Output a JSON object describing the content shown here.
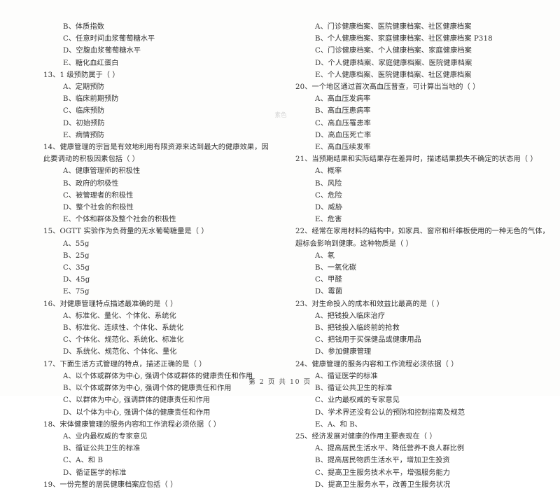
{
  "document": {
    "page_footer": "第 2 页 共 10 页",
    "artifact_text": "素色"
  },
  "left_column": {
    "leading_options": [
      "B、体质指数",
      "C、任意时间血浆葡萄糖水平",
      "D、空腹血浆葡萄糖水平",
      "E、糖化血红蛋白"
    ],
    "questions": [
      {
        "stem": "13、1 级预防属于（    ）",
        "options": [
          "A、定期预防",
          "B、临床前期预防",
          "C、临床预防",
          "D、初始预防",
          "E、病情预防"
        ]
      },
      {
        "stem": "14、健康管理的宗旨是有效地利用有限资源来达到最大的健康效果，因此要调动的积极因素包括（    ）",
        "options": [
          "A、健康管理师的积极性",
          "B、政府的积极性",
          "C、被管理者的积极性",
          "D、整个社会的积极性",
          "E、个体和群体及整个社会的积极性"
        ]
      },
      {
        "stem": "15、OGTT 实验作为负荷量的无水葡萄糖量是（    ）",
        "options": [
          "A、55g",
          "B、25g",
          "C、35g",
          "D、45g",
          "E、75g"
        ]
      },
      {
        "stem": "16、对健康管理特点描述最准确的是（    ）",
        "options": [
          "A、标准化、量化、个体化、系统化",
          "B、标准化、连续性、个体化、系统化",
          "C、个体化、规范化、系统化、标准化",
          "D、系统化、规范化、个体化、量化"
        ]
      },
      {
        "stem": "17、下面生活方式管理的特点，描述正确的是（    ）",
        "options": [
          "A、以个体或群体为中心, 强调个体或群体的健康责任和作用",
          "B、以个体或群体为中心, 强调个体的健康责任和作用",
          "C、以群体为中心, 强调群体的健康责任和作用",
          "D、以个体为中心, 强调个体的健康责任和作用"
        ]
      },
      {
        "stem": "18、宋体健康管理的服务内容和工作流程必须依据（    ）",
        "options": [
          "A、业内最权威的专家意见",
          "B、循证公共卫生的标准",
          "C、A、和 B",
          "D、循证医学的标准"
        ]
      },
      {
        "stem": "19、一份完整的居民健康档案应包括（    ）",
        "options": []
      }
    ]
  },
  "right_column": {
    "leading_options": [
      "A、门诊健康档案、医院健康档案、社区健康档案",
      "B、个人健康档案、家庭健康档案、社区健康档案 P318",
      "C、门诊健康档案、个人健康档案、家庭健康档案",
      "D、个人健康档案、家庭健康档案、医院健康档案",
      "E、个人健康档案、医院健康档案、社区健康档案"
    ],
    "questions": [
      {
        "stem": "20、一个地区通过首次高血压普查，可计算出当地的（    ）",
        "options": [
          "A、高血压发病率",
          "B、高血压患病率",
          "C、高血压罹患率",
          "D、高血压死亡率",
          "E、高血压续发率"
        ]
      },
      {
        "stem": "21、当预期结果和实际结果存在差异时，描述结果损失不确定的状态用（    ）",
        "options": [
          "A、概率",
          "B、风险",
          "C、危险",
          "D、威胁",
          "E、危害"
        ]
      },
      {
        "stem": "22、经常在家用材料的结构中，如家具、窗帘和纤维板使用的一种无色的气体，超标会影响到健康。这种物质是（    ）",
        "options": [
          "A、氡",
          "B、一氧化碳",
          "C、甲醛",
          "D、霉菌"
        ]
      },
      {
        "stem": "23、对生命投入的成本和效益比最高的是（    ）",
        "options": [
          "A、把钱投入临床治疗",
          "B、把钱投入临终前的抢救",
          "C、把钱用于买保健品或健康用品",
          "D、参加健康管理"
        ]
      },
      {
        "stem": "24、健康管理的服务内容和工作流程必须依据（    ）",
        "options": [
          "A、循证医学的标准",
          "B、循证公共卫生的标准",
          "C、业内最权威的专家意见",
          "D、学术界还没有公认的预防和控制指南及规范",
          "E、A、和 B、"
        ]
      },
      {
        "stem": "25、经济发展对健康的作用主要表现在（    ）",
        "options": [
          "A、提高居民生活水平、降低营养不良人群比例",
          "B、提高居民物质生活水平，增加卫生投资",
          "C、提高卫生服务技术水平，增强服务能力",
          "D、提高卫生服务水平，改善卫生服务状况"
        ]
      }
    ]
  }
}
